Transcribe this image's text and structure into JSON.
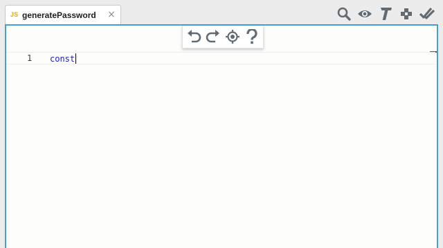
{
  "tab": {
    "lang_badge": "JS",
    "title": "generatePassword",
    "close_glyph": "×"
  },
  "top_tools": [
    {
      "icon": "search-icon"
    },
    {
      "icon": "eye-icon"
    },
    {
      "icon": "text-format-icon"
    },
    {
      "icon": "arrows-move-icon"
    },
    {
      "icon": "double-check-icon"
    }
  ],
  "float_toolbar": [
    {
      "icon": "undo-icon"
    },
    {
      "icon": "redo-icon"
    },
    {
      "icon": "crosshair-icon"
    },
    {
      "icon": "help-icon"
    }
  ],
  "editor": {
    "lines": [
      {
        "number": "1",
        "text": "const"
      }
    ]
  },
  "colors": {
    "accent_border": "#42a0d8",
    "keyword": "#2020c8",
    "lang_badge": "#e0a81f",
    "icon_gray": "#606b74"
  }
}
